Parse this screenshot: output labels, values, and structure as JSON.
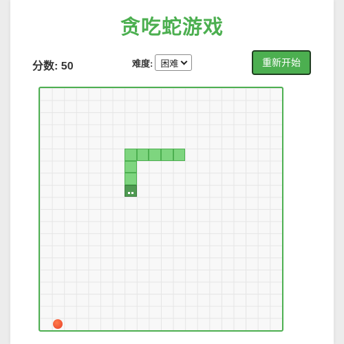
{
  "title": "贪吃蛇游戏",
  "score": {
    "label": "分数:",
    "value": "50"
  },
  "difficulty": {
    "label": "难度:",
    "selected": "困难"
  },
  "restart_label": "重新开始",
  "board": {
    "columns": 20,
    "rows": 20,
    "snake": [
      {
        "col": 7,
        "row": 8
      },
      {
        "col": 7,
        "row": 7
      },
      {
        "col": 7,
        "row": 6
      },
      {
        "col": 7,
        "row": 5
      },
      {
        "col": 8,
        "row": 5
      },
      {
        "col": 9,
        "row": 5
      },
      {
        "col": 10,
        "row": 5
      },
      {
        "col": 11,
        "row": 5
      }
    ],
    "food": {
      "col": 1,
      "row": 19
    }
  },
  "colors": {
    "accent": "#4caf50",
    "snake_body": "#7ed57f",
    "snake_head": "#4f9a52",
    "food": "#e8402a"
  }
}
